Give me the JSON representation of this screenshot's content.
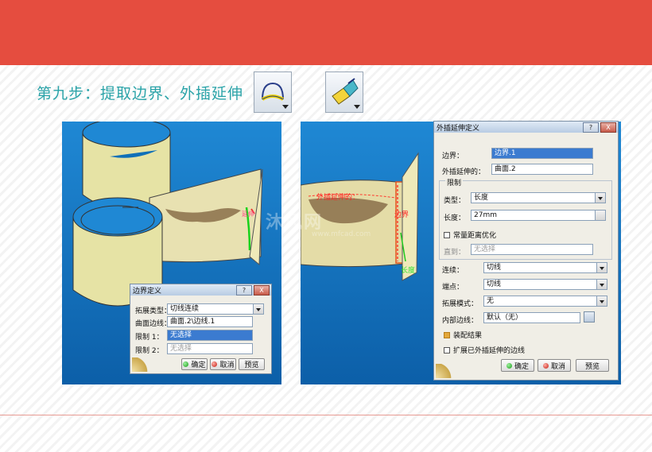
{
  "slide": {
    "title": "第九步：提取边界、外插延伸",
    "accent": "#e54d3f",
    "title_color": "#2aa3a8"
  },
  "toolbar": {
    "icons": [
      "boundary-icon",
      "extrapolate-icon"
    ]
  },
  "left_view": {
    "annotation": "延伸"
  },
  "right_view": {
    "annotation_extrapolated": "外插延伸的：",
    "annotation_boundary": "边界",
    "annotation_length": "长度"
  },
  "watermark": {
    "text": "沐风网",
    "sub": "www.mfcad.com"
  },
  "boundary_dialog": {
    "title": "边界定义",
    "help": "?",
    "close": "X",
    "propagation_label": "拓展类型：",
    "propagation_value": "切线连续",
    "surface_edge_label": "曲面边线：",
    "surface_edge_value": "曲面.2\\边线.1",
    "limit1_label": "限制 1：",
    "limit1_value": "无选择",
    "limit2_label": "限制 2：",
    "limit2_value": "无选择",
    "ok": "确定",
    "cancel": "取消",
    "preview": "预览"
  },
  "extrapolate_dialog": {
    "title": "外插延伸定义",
    "help": "?",
    "close": "X",
    "boundary_label": "边界：",
    "boundary_value": "边界.1",
    "extrapolated_label": "外插延伸的：",
    "extrapolated_value": "曲面.2",
    "limit_group": "限制",
    "type_label": "类型：",
    "type_value": "长度",
    "length_label": "长度：",
    "length_value": "27mm",
    "constant_distance": "常量距离优化",
    "up_to_label": "直到：",
    "up_to_value": "无选择",
    "continuity_label": "连续：",
    "continuity_value": "切线",
    "ends_label": "端点：",
    "ends_value": "切线",
    "propagation_label": "拓展模式：",
    "propagation_value": "无",
    "internal_edges_label": "内部边线：",
    "internal_edges_value": "默认（无）",
    "assemble_result": "装配结果",
    "assemble_checked": true,
    "extend_edges": "扩展已外插延伸的边线",
    "extend_checked": false,
    "ok": "确定",
    "cancel": "取消",
    "preview": "预览"
  }
}
